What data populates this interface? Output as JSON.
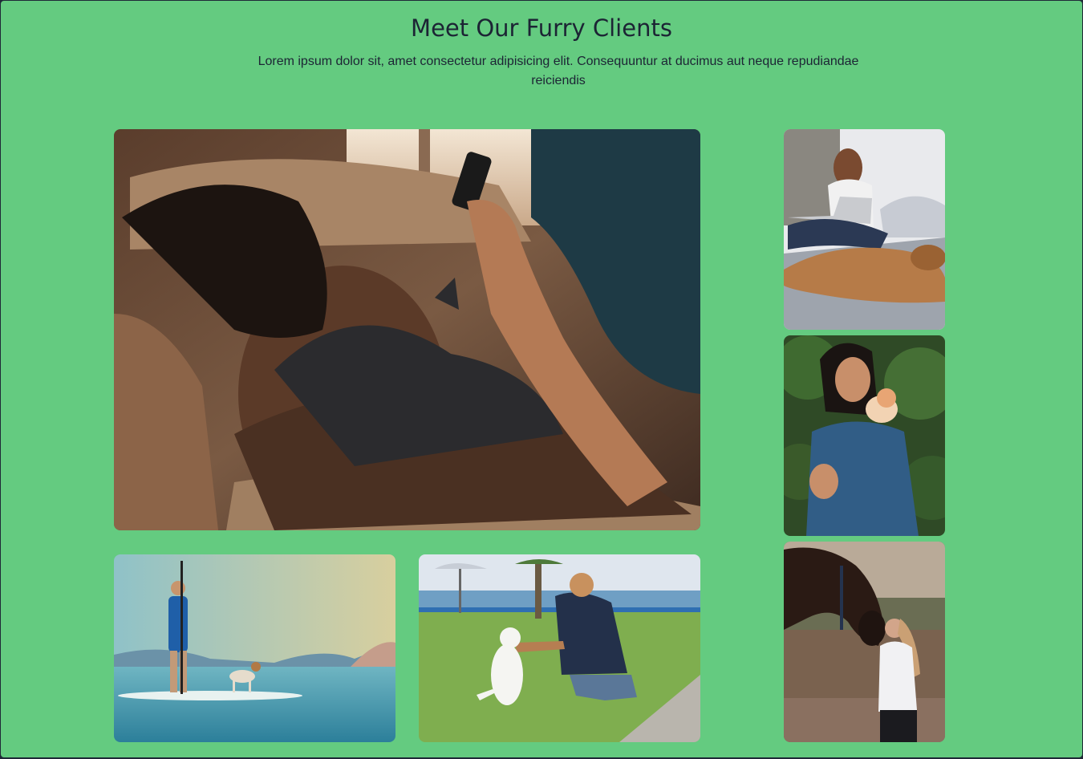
{
  "header": {
    "title": "Meet Our Furry Clients",
    "subtitle": "Lorem ipsum dolor sit, amet consectetur adipisicing elit. Consequuntur at ducimus aut neque repudiandae reiciendis"
  },
  "gallery": {
    "photos": [
      {
        "subject": "man-lying-on-couch-with-black-cat-on-chest"
      },
      {
        "subject": "man-paddleboarding-with-dog"
      },
      {
        "subject": "man-playing-with-white-cat-on-lawn"
      },
      {
        "subject": "woman-with-laptop-and-sleeping-dog"
      },
      {
        "subject": "woman-with-kitten-on-shoulder"
      },
      {
        "subject": "woman-kissing-horse"
      }
    ]
  },
  "colors": {
    "background": "#64cb80",
    "text": "#1c2434"
  }
}
